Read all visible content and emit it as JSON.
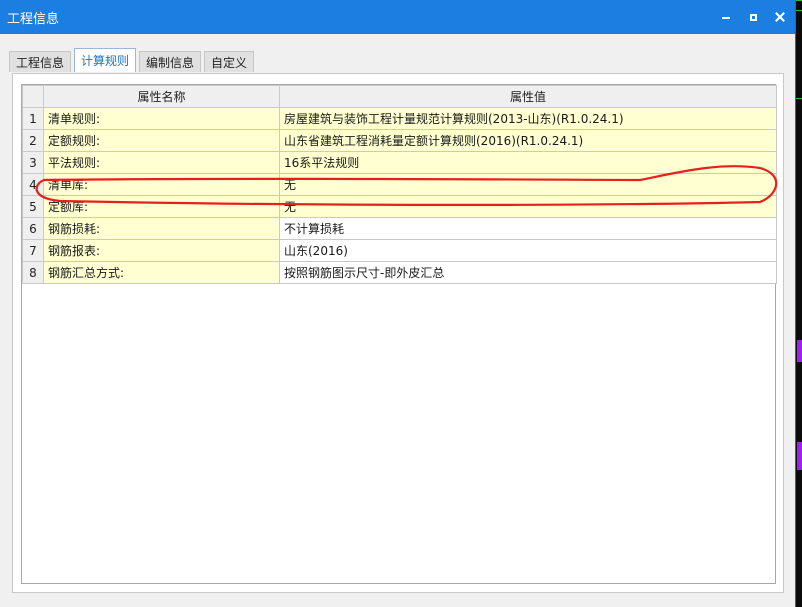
{
  "window": {
    "title": "工程信息"
  },
  "tabs": [
    {
      "label": "工程信息",
      "active": false
    },
    {
      "label": "计算规则",
      "active": true
    },
    {
      "label": "编制信息",
      "active": false
    },
    {
      "label": "自定义",
      "active": false
    }
  ],
  "table": {
    "headers": [
      "属性名称",
      "属性值"
    ],
    "rows": [
      {
        "index": "1",
        "name": "清单规则:",
        "value": "房屋建筑与装饰工程计量规范计算规则(2013-山东)(R1.0.24.1)",
        "highlight": true
      },
      {
        "index": "2",
        "name": "定额规则:",
        "value": "山东省建筑工程消耗量定额计算规则(2016)(R1.0.24.1)",
        "highlight": true
      },
      {
        "index": "3",
        "name": "平法规则:",
        "value": "16系平法规则",
        "highlight": true
      },
      {
        "index": "4",
        "name": "清单库:",
        "value": "无",
        "highlight": true
      },
      {
        "index": "5",
        "name": "定额库:",
        "value": "无",
        "highlight": true
      },
      {
        "index": "6",
        "name": "钢筋损耗:",
        "value": "不计算损耗",
        "highlight": false
      },
      {
        "index": "7",
        "name": "钢筋报表:",
        "value": "山东(2016)",
        "highlight": false
      },
      {
        "index": "8",
        "name": "钢筋汇总方式:",
        "value": "按照钢筋图示尺寸-即外皮汇总",
        "highlight": false
      }
    ]
  },
  "colors": {
    "titlebar": "#1c7ee0",
    "highlight_cell": "#ffffd2",
    "annotation": "#e8201c"
  }
}
